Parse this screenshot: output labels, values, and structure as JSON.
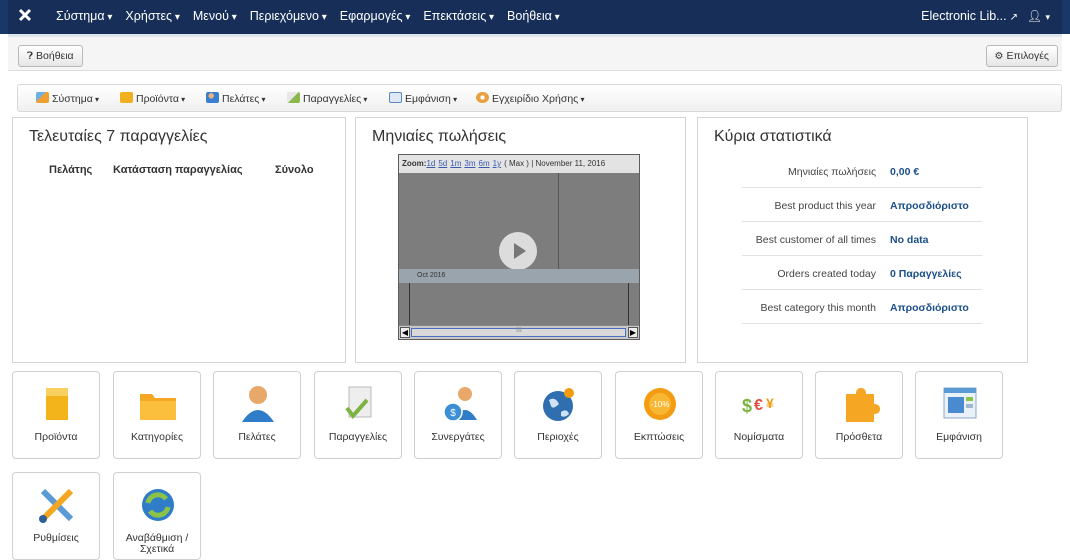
{
  "topbar": {
    "menu": [
      "Σύστημα",
      "Χρήστες",
      "Μενού",
      "Περιεχόμενο",
      "Εφαρμογές",
      "Επεκτάσεις",
      "Βοήθεια"
    ],
    "site_name": "Electronic Lib...",
    "user_icon": "user-icon"
  },
  "subhead": {
    "help_label": "Βοήθεια",
    "options_label": "Επιλογές"
  },
  "toolbar": {
    "items": [
      {
        "label": "Σύστημα",
        "icon": "tools-icon",
        "color": "#f0a030"
      },
      {
        "label": "Προϊόντα",
        "icon": "box-icon",
        "color": "#f0b020"
      },
      {
        "label": "Πελάτες",
        "icon": "users-icon",
        "color": "#3a7ed0"
      },
      {
        "label": "Παραγγελίες",
        "icon": "orders-icon",
        "color": "#8ab84a"
      },
      {
        "label": "Εμφάνιση",
        "icon": "layout-icon",
        "color": "#5a88c0"
      },
      {
        "label": "Εγχειρίδιο Χρήσης",
        "icon": "manual-icon",
        "color": "#e8a040"
      }
    ]
  },
  "orders_panel": {
    "title": "Τελευταίες 7 παραγγελίες",
    "columns": [
      "Πελάτης",
      "Κατάσταση παραγγελίας",
      "Σύνολο"
    ]
  },
  "sales_panel": {
    "title": "Μηνιαίες πωλήσεις",
    "zoom_label": "Zoom:",
    "zoom_options": [
      "1d",
      "5d",
      "1m",
      "3m",
      "6m",
      "1y"
    ],
    "zoom_max": "( Max )",
    "date_label": "| November 11, 2016",
    "band_label": "Oct 2016",
    "scroll_mid": "III"
  },
  "stats_panel": {
    "title": "Κύρια στατιστικά",
    "rows": [
      {
        "key": "Μηνιαίες πωλήσεις",
        "value": "0,00 €"
      },
      {
        "key": "Best product this year",
        "value": "Απροσδιόριστο"
      },
      {
        "key": "Best customer of all times",
        "value": "No data"
      },
      {
        "key": "Orders created today",
        "value": "0 Παραγγελίες"
      },
      {
        "key": "Best category this month",
        "value": "Απροσδιόριστο"
      }
    ]
  },
  "tiles": [
    {
      "label": "Προϊόντα",
      "icon": "box-icon"
    },
    {
      "label": "Κατηγορίες",
      "icon": "folder-icon"
    },
    {
      "label": "Πελάτες",
      "icon": "customer-icon"
    },
    {
      "label": "Παραγγελίες",
      "icon": "orders-icon"
    },
    {
      "label": "Συνεργάτες",
      "icon": "partners-icon"
    },
    {
      "label": "Περιοχές",
      "icon": "globe-icon"
    },
    {
      "label": "Εκπτώσεις",
      "icon": "discount-icon"
    },
    {
      "label": "Νομίσματα",
      "icon": "currency-icon"
    },
    {
      "label": "Πρόσθετα",
      "icon": "puzzle-icon"
    },
    {
      "label": "Εμφάνιση",
      "icon": "layout-icon"
    },
    {
      "label": "Ρυθμίσεις",
      "icon": "settings-icon"
    },
    {
      "label": "Αναβάθμιση / Σχετικά",
      "icon": "update-icon"
    }
  ]
}
